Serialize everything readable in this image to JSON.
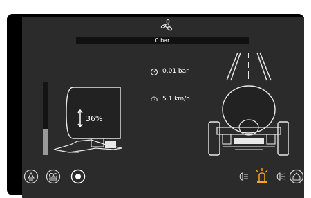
{
  "pressure_bar": {
    "label": "0 bar",
    "fill_fraction": 0.0
  },
  "fan_icon": "fan-icon",
  "readouts": {
    "pressure": {
      "value": "0.01 bar",
      "icon": "gauge-icon"
    },
    "speed": {
      "value": "5.1 km/h",
      "icon": "speedometer-icon"
    }
  },
  "tank": {
    "fill_percent_label": "36%",
    "fill_level": 0.36
  },
  "bottom_left_icons": [
    "nozzle-icon",
    "section-control-icon",
    "record-button-icon"
  ],
  "bottom_right_icons": [
    "work-light-icon",
    "beacon-icon",
    "headlight-icon",
    "home-icon"
  ],
  "colors": {
    "background": "#2b2b2b",
    "accent_orange": "#f5a623",
    "bar": "#111111",
    "level_fill": "#9a9a9a"
  }
}
